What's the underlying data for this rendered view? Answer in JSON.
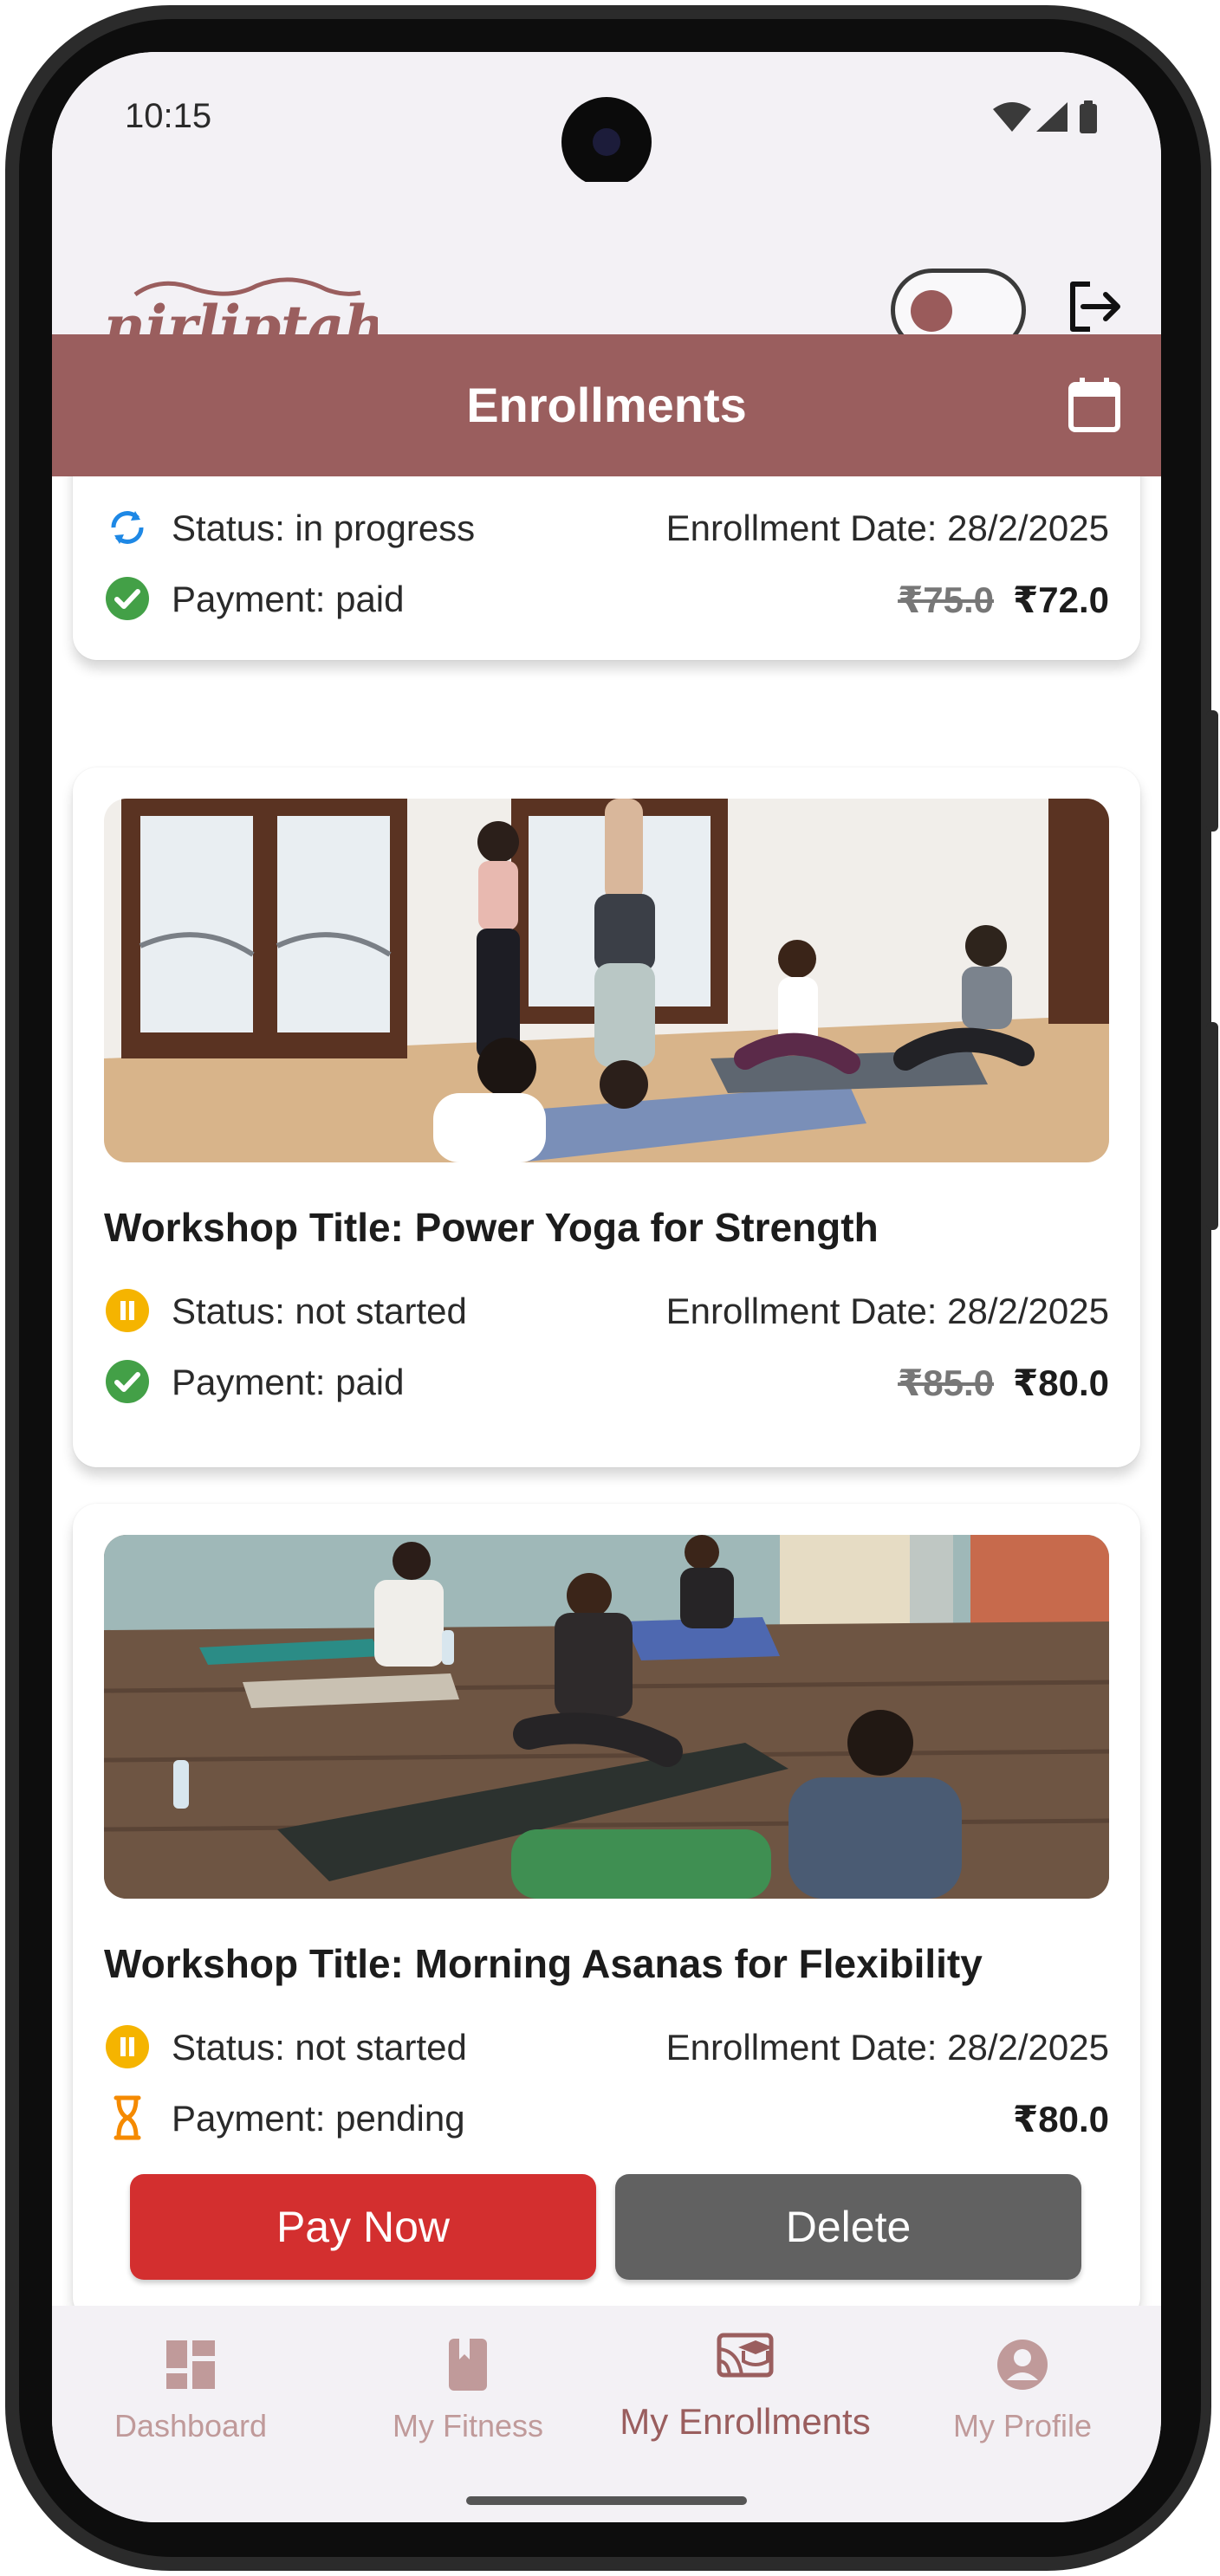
{
  "status_bar": {
    "time": "10:15"
  },
  "app": {
    "logo_text": "nirliptah",
    "header_title": "Enrollments"
  },
  "cards": [
    {
      "status": "Status: in progress",
      "enrollment_date": "Enrollment Date: 28/2/2025",
      "payment": "Payment: paid",
      "price_old": "₹75.0",
      "price_new": "₹72.0"
    },
    {
      "title": "Workshop Title: Power Yoga for Strength",
      "status": "Status: not started",
      "enrollment_date": "Enrollment Date: 28/2/2025",
      "payment": "Payment: paid",
      "price_old": "₹85.0",
      "price_new": "₹80.0"
    },
    {
      "title": "Workshop Title: Morning Asanas for Flexibility",
      "status": "Status: not started",
      "enrollment_date": "Enrollment Date: 28/2/2025",
      "payment": "Payment: pending",
      "price_new": "₹80.0",
      "pay_label": "Pay Now",
      "delete_label": "Delete"
    }
  ],
  "bottom_nav": [
    {
      "label": "Dashboard",
      "icon": "dashboard-icon"
    },
    {
      "label": "My Fitness",
      "icon": "book-icon"
    },
    {
      "label": "My Enrollments",
      "icon": "enrollments-icon",
      "active": true
    },
    {
      "label": "My Profile",
      "icon": "profile-icon"
    }
  ],
  "colors": {
    "brand": "#9a5e5e",
    "paid_green": "#43a047",
    "in_progress_blue": "#1e88e5",
    "not_started_amber": "#f5b400",
    "pending_orange": "#f58a00",
    "pay_button": "#d32f2f",
    "delete_button": "#616161"
  }
}
